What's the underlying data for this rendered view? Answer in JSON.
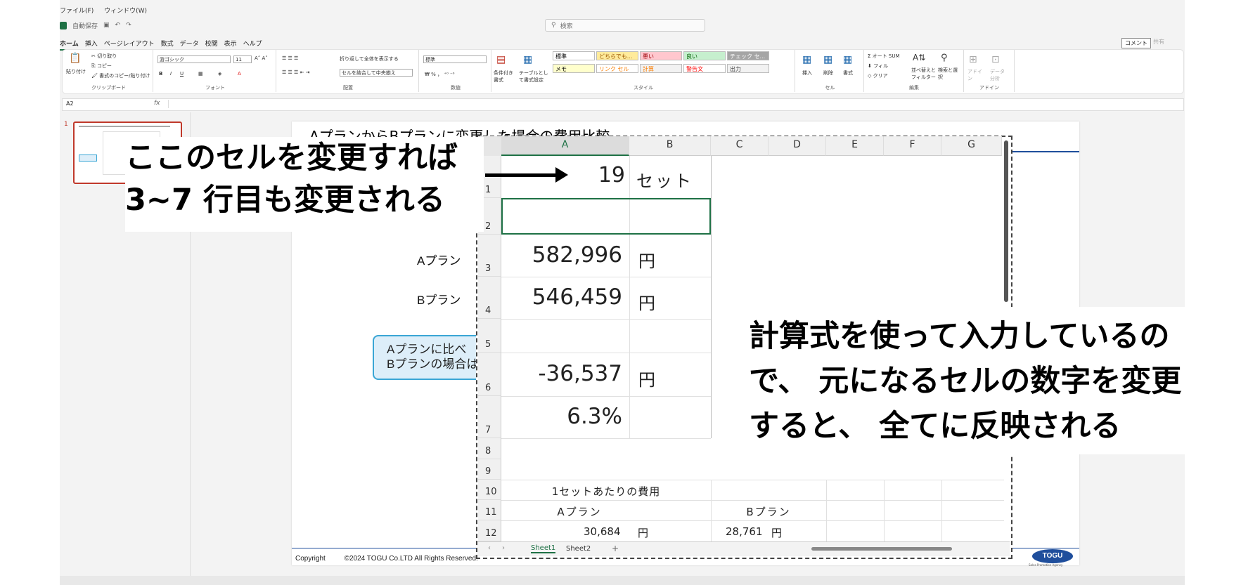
{
  "menu": {
    "file": "ファイル(F)",
    "window": "ウィンドウ(W)"
  },
  "qat": {
    "autosave": "自動保存"
  },
  "search": {
    "placeholder": "検索"
  },
  "tabs": [
    "ホーム",
    "挿入",
    "ページレイアウト",
    "数式",
    "データ",
    "校閲",
    "表示",
    "ヘルプ"
  ],
  "header_buttons": {
    "comment": "コメント",
    "share": "共有"
  },
  "ribbon": {
    "clipboard": {
      "paste": "貼り付け",
      "cut": "切り取り",
      "copy": "コピー",
      "format_painter": "書式のコピー/貼り付け",
      "label": "クリップボード"
    },
    "font": {
      "name": "游ゴシック",
      "size": "11",
      "label": "フォント"
    },
    "alignment": {
      "wrap": "折り返して全体を表示する",
      "merge": "セルを結合して中央揃え",
      "label": "配置"
    },
    "number": {
      "format": "標準",
      "label": "数値"
    },
    "styles": {
      "conditional": "条件付き書式",
      "table": "テーブルとして書式設定",
      "cells": [
        {
          "text": "標準",
          "bg": "#ffffff",
          "color": "#000000"
        },
        {
          "text": "どちらでも...",
          "bg": "#ffeb9c",
          "color": "#9c5700"
        },
        {
          "text": "悪い",
          "bg": "#ffc7ce",
          "color": "#9c0006"
        },
        {
          "text": "良い",
          "bg": "#c6efce",
          "color": "#006100"
        },
        {
          "text": "チェック セ...",
          "bg": "#a5a5a5",
          "color": "#ffffff"
        },
        {
          "text": "メモ",
          "bg": "#ffffcc",
          "color": "#000000"
        },
        {
          "text": "リンク セル",
          "bg": "#ffffff",
          "color": "#fa7d00"
        },
        {
          "text": "計算",
          "bg": "#f2f2f2",
          "color": "#fa7d00"
        },
        {
          "text": "警告文",
          "bg": "#ffffff",
          "color": "#ff0000"
        },
        {
          "text": "出力",
          "bg": "#f2f2f2",
          "color": "#3f3f3f"
        }
      ],
      "label": "スタイル"
    },
    "cells": {
      "insert": "挿入",
      "delete": "削除",
      "format": "書式",
      "label": "セル"
    },
    "editing": {
      "autosum": "オート SUM",
      "fill": "フィル",
      "clear": "クリア",
      "sort": "並べ替えとフィルター",
      "find": "検索と選択",
      "label": "編集"
    },
    "addins": {
      "addin": "アドイン",
      "analyze": "データ分析",
      "label": "アドイン"
    }
  },
  "formula_bar": {
    "namebox": "A2",
    "fx": "fx"
  },
  "slide_panel": {
    "number": "1"
  },
  "slide": {
    "title": "AプランからBプランに変更した場合の費用比較",
    "label_a": "Aプラン",
    "label_b": "Bプラン",
    "callout_line1": "Aプランに比べ",
    "callout_line2": "Bプランの場合は",
    "copyright_label": "Copyright",
    "copyright_text": "©2024 TOGU Co.LTD All Rights Reserved.",
    "logo": "TOGU",
    "logo_sub": "Sales Promotion Agency"
  },
  "sheet": {
    "columns": [
      "A",
      "B",
      "C",
      "D",
      "E",
      "F",
      "G"
    ],
    "rows": [
      "1",
      "2",
      "3",
      "4",
      "5",
      "6",
      "7",
      "8",
      "9",
      "10",
      "11",
      "12"
    ],
    "r1_a": "19",
    "r1_b": "セット",
    "r3_a": "582,996",
    "r3_b": "円",
    "r4_a": "546,459",
    "r4_b": "円",
    "r6_a": "-36,537",
    "r6_b": "円",
    "r7_a": "6.3%",
    "r10_title": "1セットあたりの費用",
    "r11_a": "Aプラン",
    "r11_b": "Bプラン",
    "r12_a": "30,684",
    "r12_a_unit": "円",
    "r12_b": "28,761",
    "r12_b_unit": "円",
    "tab1": "Sheet1",
    "tab2": "Sheet2",
    "add_tab": "+"
  },
  "annotations": {
    "top_line1": "ここのセルを変更すれば",
    "top_line2": "3~7 行目も変更される",
    "right_line1": "計算式を使って入力しているの",
    "right_line2": "で、 元になるセルの数字を変更",
    "right_line3": "すると、 全てに反映される"
  }
}
